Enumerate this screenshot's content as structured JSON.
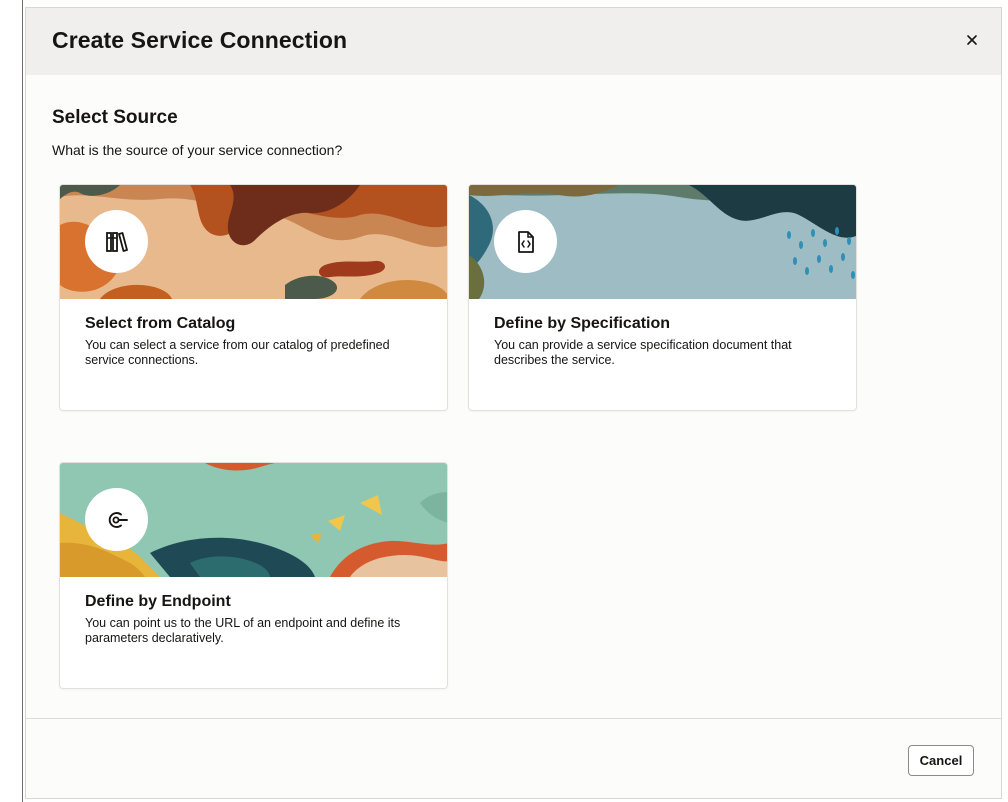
{
  "dialog": {
    "title": "Create Service Connection",
    "close_icon": "close-icon"
  },
  "section": {
    "title": "Select Source",
    "subtitle": "What is the source of your service connection?"
  },
  "cards": [
    {
      "title": "Select from Catalog",
      "description": "You can select a service from our catalog of predefined service connections.",
      "icon": "catalog-books-icon",
      "palette": [
        "#e8b98d",
        "#b4521f",
        "#6e2d1a",
        "#4b5a4a"
      ]
    },
    {
      "title": "Define by Specification",
      "description": "You can provide a service specification document that describes the service.",
      "icon": "specification-document-icon",
      "palette": [
        "#9ebcc4",
        "#1d3b42",
        "#2f6a7a",
        "#6a6f3d"
      ]
    },
    {
      "title": "Define by Endpoint",
      "description": "You can point us to the URL of an endpoint and define its parameters declaratively.",
      "icon": "endpoint-icon",
      "palette": [
        "#8fc7b2",
        "#e6b53a",
        "#d55b2f",
        "#1f4a55"
      ]
    }
  ],
  "footer": {
    "cancel_label": "Cancel"
  }
}
